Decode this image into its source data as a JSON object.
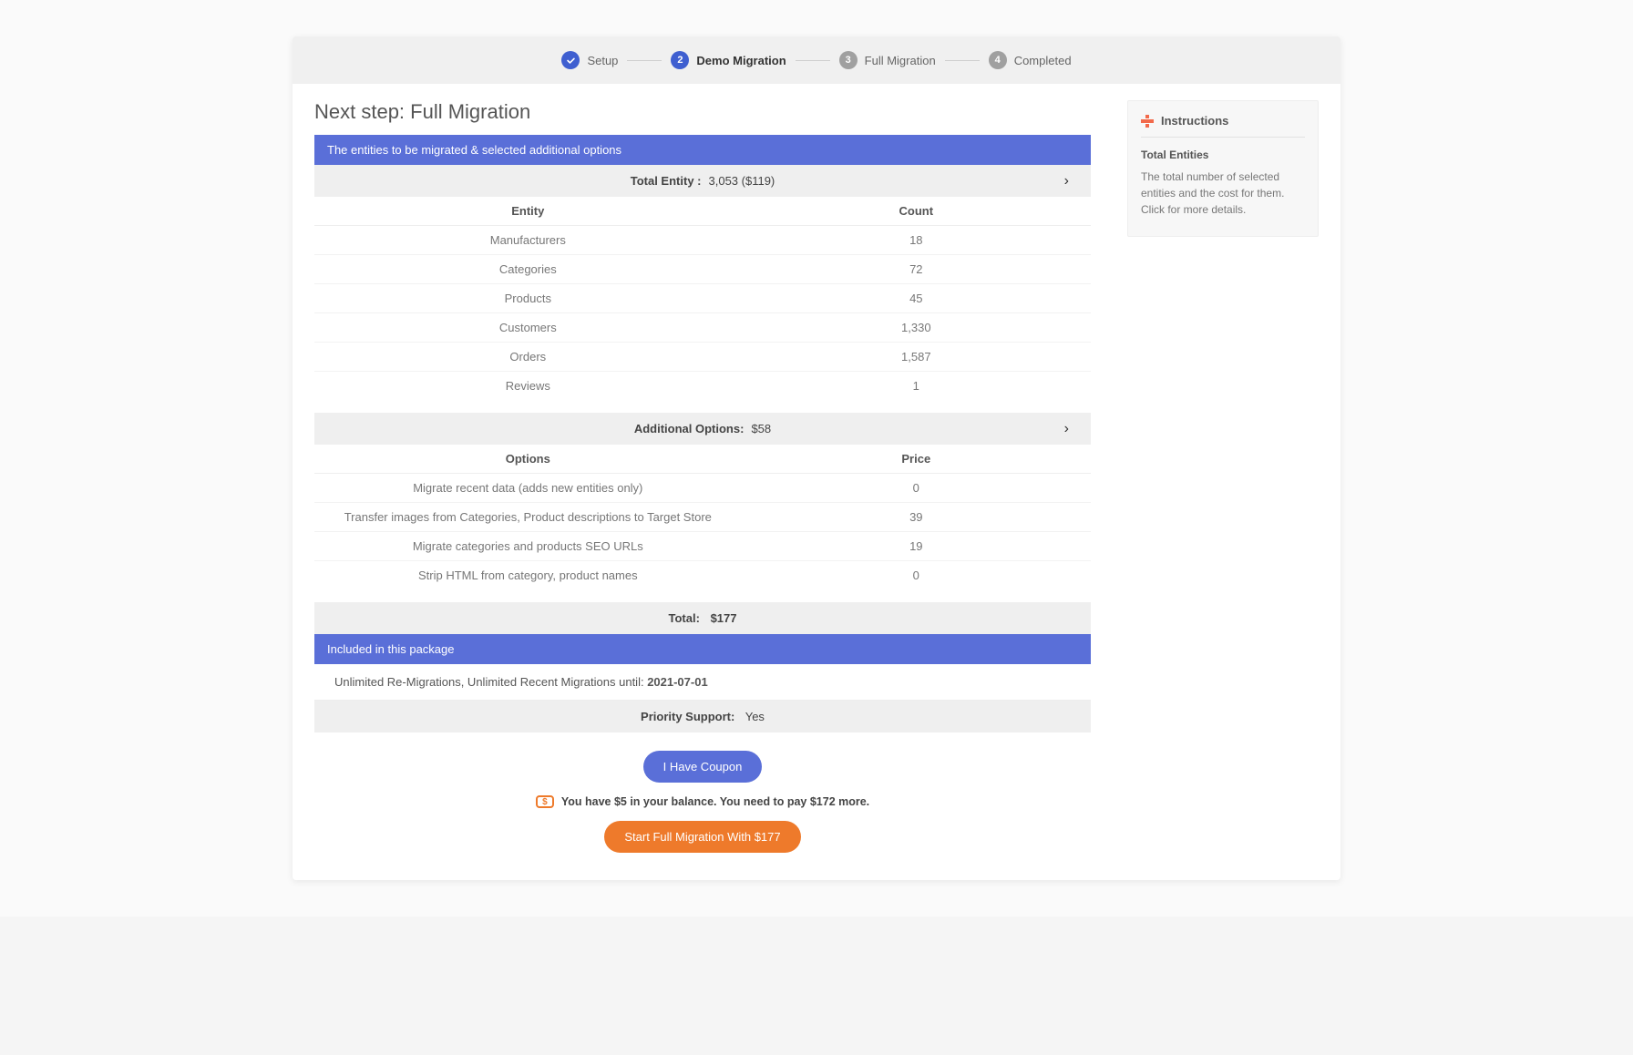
{
  "stepper": {
    "steps": [
      {
        "label": "Setup",
        "state": "done"
      },
      {
        "label": "Demo Migration",
        "state": "active",
        "num": "2"
      },
      {
        "label": "Full Migration",
        "state": "pending",
        "num": "3"
      },
      {
        "label": "Completed",
        "state": "pending",
        "num": "4"
      }
    ]
  },
  "page": {
    "title": "Next step: Full Migration"
  },
  "entities_panel": {
    "header": "The entities to be migrated & selected additional options",
    "total_label": "Total Entity :",
    "total_value": "3,053 ($119)",
    "columns": {
      "entity": "Entity",
      "count": "Count"
    },
    "rows": [
      {
        "entity": "Manufacturers",
        "count": "18"
      },
      {
        "entity": "Categories",
        "count": "72"
      },
      {
        "entity": "Products",
        "count": "45"
      },
      {
        "entity": "Customers",
        "count": "1,330"
      },
      {
        "entity": "Orders",
        "count": "1,587"
      },
      {
        "entity": "Reviews",
        "count": "1"
      }
    ]
  },
  "options_panel": {
    "total_label": "Additional Options:",
    "total_value": "$58",
    "columns": {
      "option": "Options",
      "price": "Price"
    },
    "rows": [
      {
        "option": "Migrate recent data (adds new entities only)",
        "price": "0"
      },
      {
        "option": "Transfer images from Categories, Product descriptions to Target Store",
        "price": "39"
      },
      {
        "option": "Migrate categories and products SEO URLs",
        "price": "19"
      },
      {
        "option": "Strip HTML from category, product names",
        "price": "0"
      }
    ]
  },
  "totals": {
    "label": "Total:",
    "value": "$177"
  },
  "package": {
    "header": "Included in this package",
    "line_prefix": "Unlimited Re-Migrations, Unlimited Recent Migrations until: ",
    "line_date": "2021-07-01",
    "priority_label": "Priority Support:",
    "priority_value": "Yes"
  },
  "actions": {
    "coupon_btn": "I Have Coupon",
    "balance_line": "You have $5 in your balance. You need to pay $172 more.",
    "start_btn": "Start Full Migration With $177"
  },
  "instructions": {
    "title": "Instructions",
    "subhead": "Total Entities",
    "body": "The total number of selected entities and the cost for them. Click for more details."
  }
}
